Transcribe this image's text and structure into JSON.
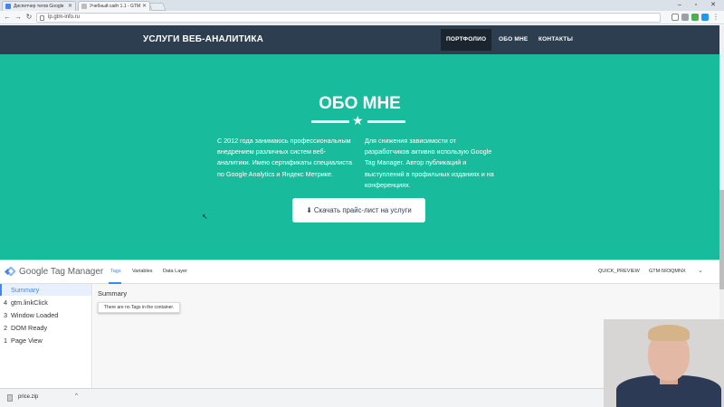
{
  "browser": {
    "tabs": [
      {
        "label": "Диспетчер тегов Google",
        "icon_color": "#4285f4"
      },
      {
        "label": "Учебный сайт 1.1 - GTM",
        "icon_color": "#9e9e9e"
      }
    ],
    "url": "lp.gtm-info.ru"
  },
  "site": {
    "brand": "УСЛУГИ ВЕБ-АНАЛИТИКА",
    "nav": [
      "ПОРТФОЛИО",
      "ОБО МНЕ",
      "КОНТАКТЫ"
    ],
    "hero": {
      "title": "ОБО МНЕ",
      "left_text": "С 2012 года занимаюсь профессиональным внедрением различных систем веб-аналитики. Имею сертификаты специалиста по Google Analytics и Яндекс Метрике.",
      "right_text": "Для снижения зависимости от разработчиков активно использую Google Tag Manager. Автор публикаций и выступлений в профильных изданиях и на конференциях.",
      "button_label": "Скачать прайс-лист на услуги"
    },
    "colors": {
      "header": "#2c3e50",
      "hero": "#18bc9c"
    }
  },
  "gtm": {
    "product": "Google Tag Manager",
    "tabs": [
      "Tags",
      "Variables",
      "Data Layer"
    ],
    "quick_preview": "QUICK_PREVIEW",
    "container_id": "GTM-5R3QMNX",
    "events": [
      {
        "num": "",
        "label": "Summary"
      },
      {
        "num": "4",
        "label": "gtm.linkClick"
      },
      {
        "num": "3",
        "label": "Window Loaded"
      },
      {
        "num": "2",
        "label": "DOM Ready"
      },
      {
        "num": "1",
        "label": "Page View"
      }
    ],
    "main_title": "Summary",
    "empty_message": "There are no Tags in the container."
  },
  "download": {
    "filename": "price.zip"
  }
}
